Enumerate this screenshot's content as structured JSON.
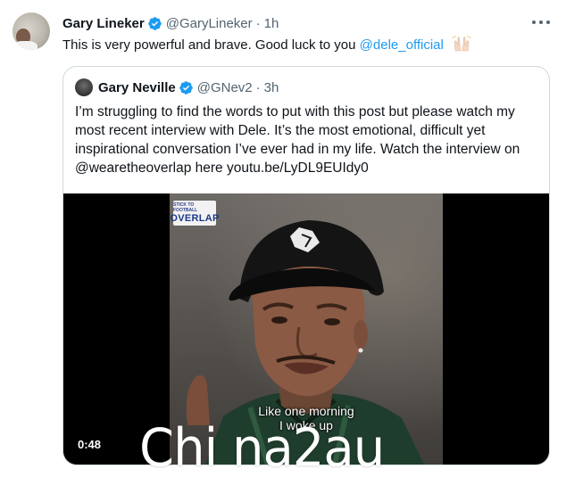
{
  "tweet": {
    "author_name": "Gary Lineker",
    "author_handle": "@GaryLineker",
    "separator": "·",
    "time": "1h",
    "text_main": "This is very powerful and brave. Good luck to you ",
    "mention": "@dele_official",
    "emoji": "raised-hands"
  },
  "quote": {
    "author_name": "Gary Neville",
    "author_handle": "@GNev2",
    "separator": "·",
    "time": "3h",
    "text": "I’m struggling to find the words to put with this post but please watch my most recent interview with Dele. It’s the most emotional, difficult yet inspirational conversation I’ve ever had in my life. Watch the interview on @wearetheoverlap here youtu.be/LyDL9EUIdy0"
  },
  "video": {
    "logo_small": "STICK TO FOOTBALL",
    "logo_big": "OVERLAP",
    "subtitle_line1": "Like one morning",
    "subtitle_line2": "I woke up",
    "duration": "0:48"
  },
  "watermark": "Chi na2au",
  "colors": {
    "link": "#1d9bf0",
    "verified": "#1d9bf0",
    "text": "#0f1419",
    "secondary": "#536471",
    "border": "#cfd9de"
  }
}
